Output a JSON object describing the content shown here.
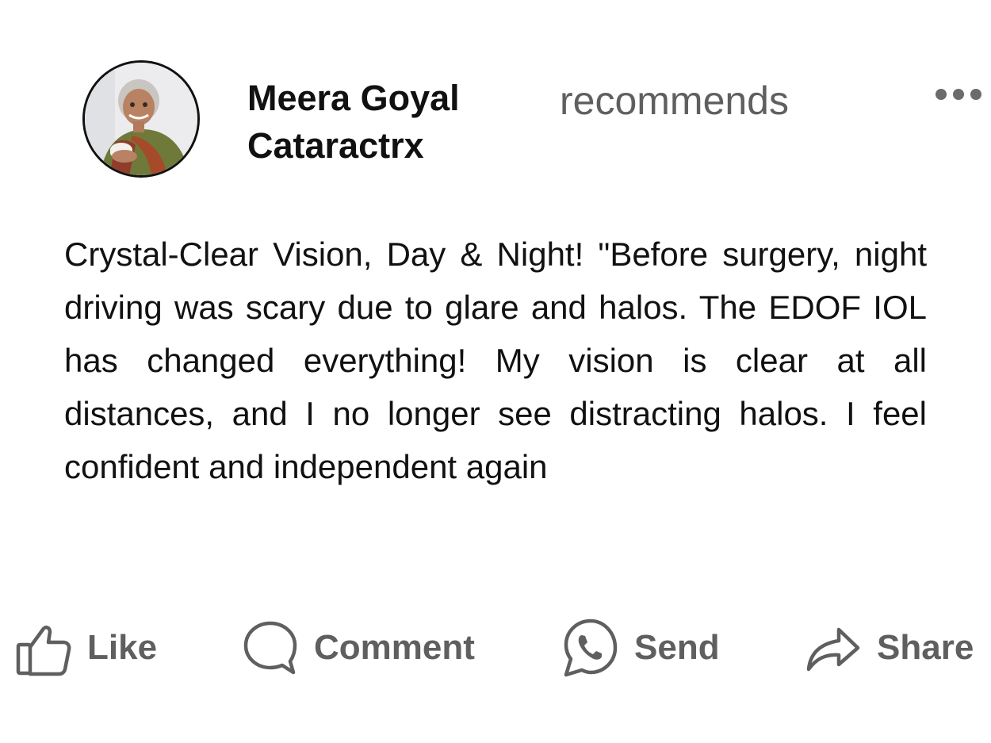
{
  "post": {
    "author_line1": "Meera Goyal",
    "author_line2": "Cataractrx",
    "action_verb": "recommends",
    "text": "Crystal-Clear Vision, Day & Night! \"Before surgery, night driving was scary due to glare and halos. The EDOF IOL has changed everything! My vision is clear at all distances, and I no longer see distracting halos. I feel confident and independent again"
  },
  "actions": {
    "like": "Like",
    "comment": "Comment",
    "send": "Send",
    "share": "Share"
  },
  "icons": {
    "more": "more-horizontal-icon",
    "like": "thumbs-up-icon",
    "comment": "comment-bubble-icon",
    "send": "whatsapp-icon",
    "share": "share-arrow-icon"
  },
  "colors": {
    "text": "#111111",
    "muted": "#5f5f5f"
  }
}
